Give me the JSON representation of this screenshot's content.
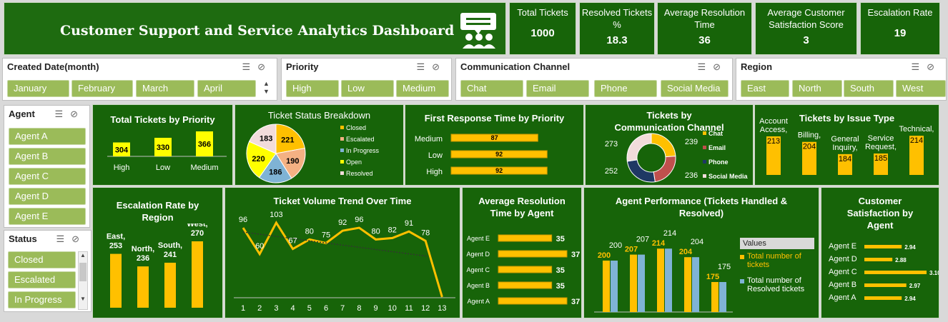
{
  "dashboard": {
    "title": "Customer Support and Service Analytics Dashboard"
  },
  "kpis": [
    {
      "label": "Total Tickets",
      "value": "1000"
    },
    {
      "label": "Resolved Tickets %",
      "value": "18.3"
    },
    {
      "label": "Average Resolution Time",
      "value": "36"
    },
    {
      "label": "Average Customer Satisfaction Score",
      "value": "3"
    },
    {
      "label": "Escalation Rate",
      "value": "19"
    }
  ],
  "slicers": {
    "created_date": {
      "title": "Created Date(month)",
      "items": [
        "January",
        "February",
        "March",
        "April"
      ]
    },
    "priority": {
      "title": "Priority",
      "items": [
        "High",
        "Low",
        "Medium"
      ]
    },
    "channel": {
      "title": "Communication Channel",
      "items": [
        "Chat",
        "Email",
        "Phone",
        "Social Media"
      ]
    },
    "region": {
      "title": "Region",
      "items": [
        "East",
        "North",
        "South",
        "West"
      ]
    },
    "agent": {
      "title": "Agent",
      "items": [
        "Agent A",
        "Agent B",
        "Agent C",
        "Agent D",
        "Agent E"
      ]
    },
    "status": {
      "title": "Status",
      "items": [
        "Closed",
        "Escalated",
        "In Progress"
      ]
    }
  },
  "charts": {
    "priority": {
      "title": "Total Tickets by Priority"
    },
    "status": {
      "title": "Ticket Status Breakdown"
    },
    "first_response": {
      "title": "First Response Time by Priority"
    },
    "channel": {
      "title": "Tickets by Communication Channel"
    },
    "issue": {
      "title": "Tickets by Issue Type"
    },
    "escalation": {
      "title": "Escalation Rate by Region"
    },
    "trend": {
      "title": "Ticket Volume Trend Over Time"
    },
    "avg_res": {
      "title": "Average Resolution Time by Agent"
    },
    "agent_perf": {
      "title": "Agent Performance (Tickets Handled & Resolved)",
      "legend_title": "Values"
    },
    "csat": {
      "title": "Customer Satisfaction by Agent"
    }
  },
  "chart_data": [
    {
      "type": "bar",
      "title": "Total Tickets by Priority",
      "categories": [
        "High",
        "Low",
        "Medium"
      ],
      "values": [
        304,
        330,
        366
      ],
      "color": "#ffff00"
    },
    {
      "type": "pie",
      "title": "Ticket Status Breakdown",
      "categories": [
        "Closed",
        "Escalated",
        "In Progress",
        "Open",
        "Resolved"
      ],
      "values": [
        221,
        190,
        186,
        220,
        183
      ],
      "colors": [
        "#ffc000",
        "#f4b183",
        "#7fb3d5",
        "#ffff00",
        "#f2dcdb"
      ]
    },
    {
      "type": "bar",
      "orientation": "horizontal",
      "title": "First Response Time by Priority",
      "categories": [
        "Medium",
        "Low",
        "High"
      ],
      "values": [
        87,
        92,
        92
      ]
    },
    {
      "type": "pie",
      "donut": true,
      "title": "Tickets by Communication Channel",
      "categories": [
        "Chat",
        "Email",
        "Phone",
        "Social Media"
      ],
      "values": [
        239,
        236,
        252,
        273
      ],
      "colors": [
        "#ffc000",
        "#c0504d",
        "#1f3864",
        "#f2dcdb"
      ]
    },
    {
      "type": "bar",
      "title": "Tickets by Issue Type",
      "categories": [
        "Account Access,",
        "Billing,",
        "General Inquiry,",
        "Service Request,",
        "Technical,"
      ],
      "values": [
        213,
        204,
        184,
        185,
        214
      ]
    },
    {
      "type": "bar",
      "title": "Escalation Rate by Region",
      "categories": [
        "East,",
        "North,",
        "South,",
        "West,"
      ],
      "values": [
        253,
        236,
        241,
        270
      ]
    },
    {
      "type": "line",
      "title": "Ticket Volume Trend Over Time",
      "x": [
        1,
        2,
        3,
        4,
        5,
        6,
        7,
        8,
        9,
        10,
        11,
        12,
        13
      ],
      "values": [
        96,
        60,
        103,
        67,
        80,
        75,
        92,
        96,
        80,
        82,
        91,
        78,
        1
      ],
      "labels": [
        "96",
        "60",
        "103",
        "67",
        "80",
        "75",
        "92",
        "96",
        "80",
        "82",
        "91",
        "78",
        ""
      ]
    },
    {
      "type": "bar",
      "orientation": "horizontal",
      "title": "Average Resolution Time by Agent",
      "categories": [
        "Agent E",
        "Agent D",
        "Agent C",
        "Agent B",
        "Agent A"
      ],
      "values": [
        35,
        37,
        35,
        35,
        37
      ]
    },
    {
      "type": "bar",
      "title": "Agent Performance (Tickets Handled & Resolved)",
      "series": [
        {
          "name": "Total number of tickets",
          "values": [
            200,
            207,
            214,
            204,
            175
          ]
        },
        {
          "name": "Total number of Resolved tickets",
          "values": [
            200,
            207,
            214,
            204,
            175
          ]
        }
      ],
      "categories": [
        "1",
        "2",
        "3",
        "4",
        "5"
      ]
    },
    {
      "type": "bar",
      "orientation": "horizontal",
      "title": "Customer Satisfaction by Agent",
      "categories": [
        "Agent E",
        "Agent D",
        "Agent C",
        "Agent B",
        "Agent A"
      ],
      "values": [
        2.94,
        2.88,
        3.1,
        2.97,
        2.94
      ],
      "labels": [
        "2.94",
        "2.88",
        "3.10",
        "2.97",
        "2.94"
      ]
    }
  ]
}
